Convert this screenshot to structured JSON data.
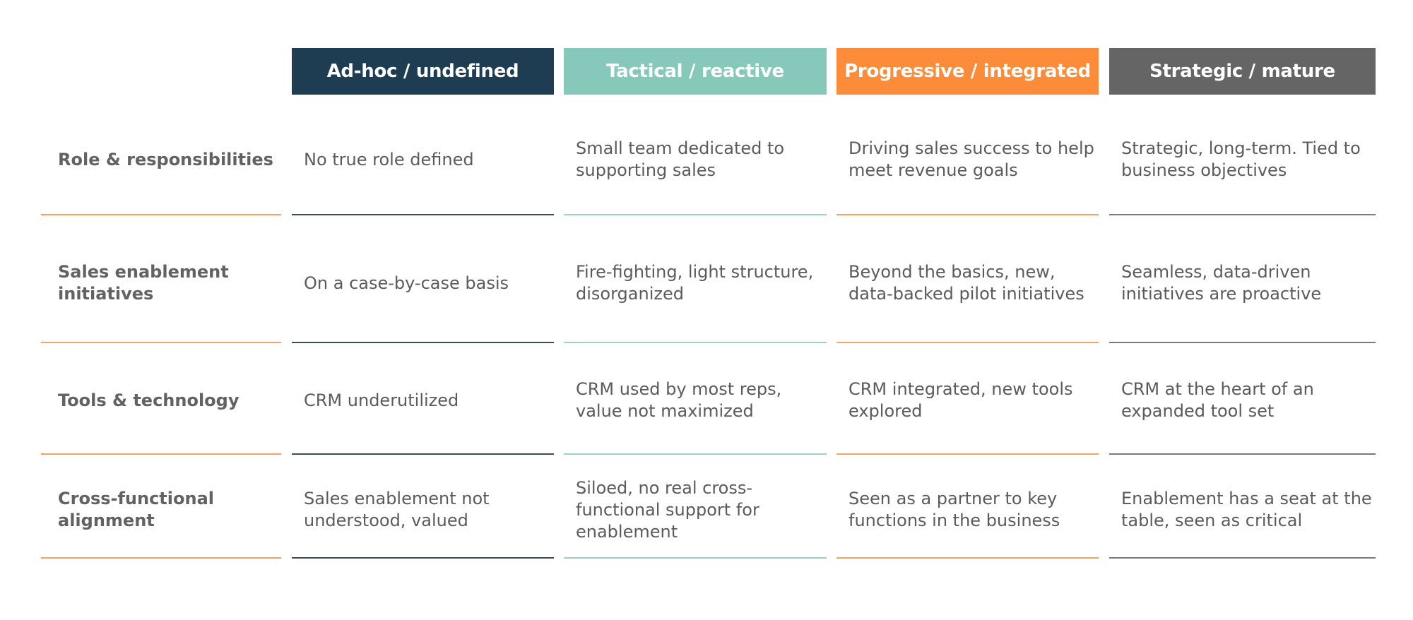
{
  "colors": {
    "ad_hoc": "#1f3d52",
    "tactical": "#86c9bb",
    "progressive": "#fd8c3a",
    "strategic": "#656565",
    "label_line": "#f4a261",
    "text": "#5b5b5b"
  },
  "headers": [
    "Ad-hoc / undefined",
    "Tactical / reactive",
    "Progressive / integrated",
    "Strategic / mature"
  ],
  "rows": [
    {
      "label": "Role & responsibilities",
      "cells": [
        "No true role defined",
        "Small team dedicated to supporting sales",
        "Driving sales success to help meet revenue goals",
        "Strategic, long-term. Tied to business objectives"
      ]
    },
    {
      "label": "Sales enablement initiatives",
      "cells": [
        "On a case-by-case basis",
        "Fire-fighting, light structure, disorganized",
        "Beyond the basics, new, data-backed pilot initiatives",
        "Seamless, data-driven initiatives are proactive"
      ]
    },
    {
      "label": "Tools & technology",
      "cells": [
        "CRM underutilized",
        "CRM used by most reps, value not maximized",
        "CRM integrated, new tools explored",
        "CRM at the heart of an expanded tool set"
      ]
    },
    {
      "label": "Cross-functional alignment",
      "cells": [
        "Sales enablement not understood, valued",
        "Siloed, no real cross-functional support for enablement",
        "Seen as a partner to key functions in the business",
        "Enablement has a seat at the table, seen as critical"
      ]
    }
  ]
}
